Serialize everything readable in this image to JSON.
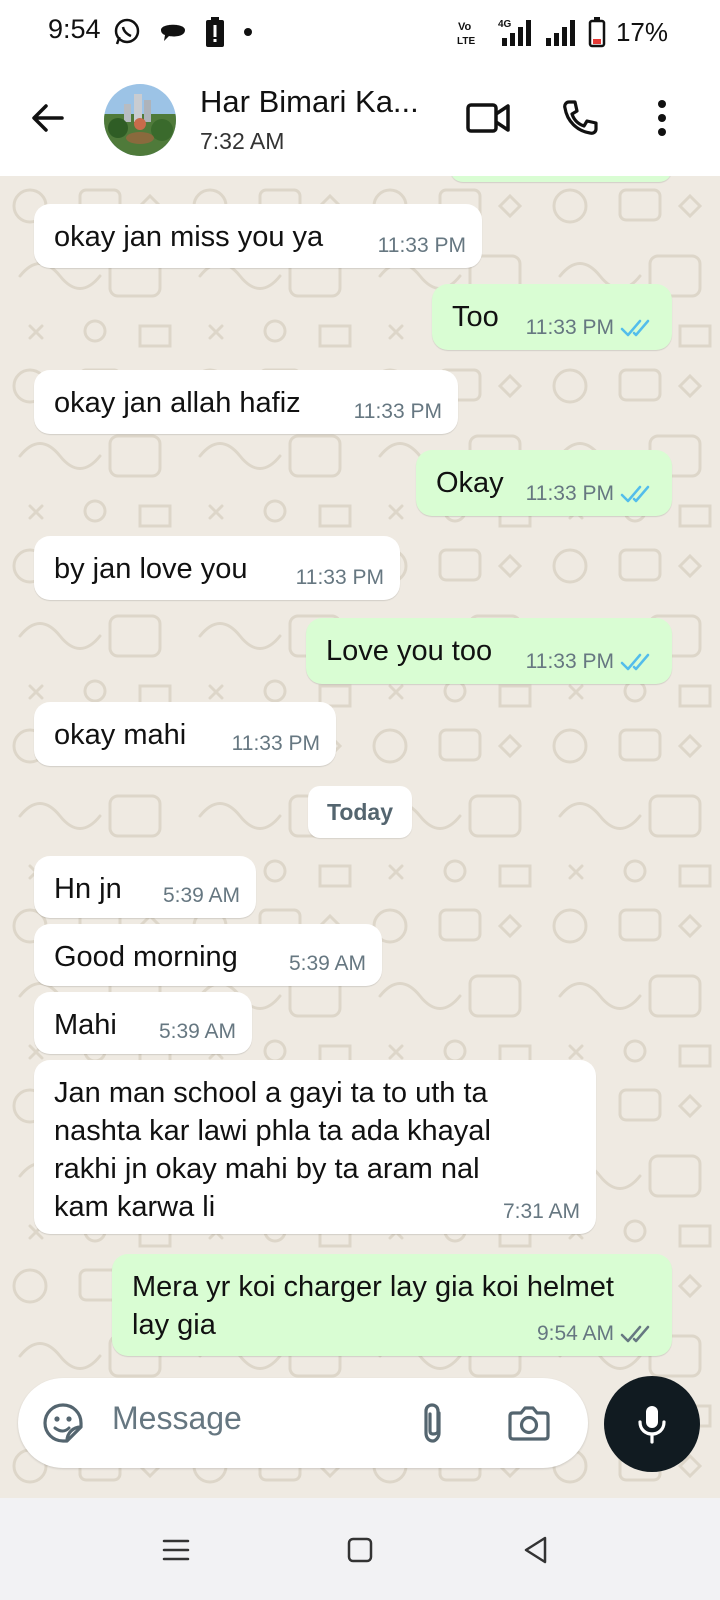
{
  "status_bar": {
    "time": "9:54",
    "network_4g": "4G",
    "volte": "Vo LTE",
    "battery_percent": "17%"
  },
  "header": {
    "contact_name": "Har Bimari Ka...",
    "last_seen": "7:32 AM"
  },
  "messages": [
    {
      "direction": "in",
      "text": "okay jan miss you ya",
      "time": "11:33 PM"
    },
    {
      "direction": "out",
      "text": "Too",
      "time": "11:33 PM",
      "status": "read"
    },
    {
      "direction": "in",
      "text": "okay jan allah hafiz",
      "time": "11:33 PM"
    },
    {
      "direction": "out",
      "text": "Okay",
      "time": "11:33 PM",
      "status": "read"
    },
    {
      "direction": "in",
      "text": "by jan love you",
      "time": "11:33 PM"
    },
    {
      "direction": "out",
      "text": "Love you too",
      "time": "11:33 PM",
      "status": "read"
    },
    {
      "direction": "in",
      "text": "okay mahi",
      "time": "11:33 PM"
    },
    {
      "direction": "in",
      "text": "Hn jn",
      "time": "5:39 AM"
    },
    {
      "direction": "in",
      "text": "Good morning",
      "time": "5:39 AM"
    },
    {
      "direction": "in",
      "text": "Mahi",
      "time": "5:39 AM"
    },
    {
      "direction": "in",
      "text_lines": [
        "Jan man school a gayi ta to uth ta",
        "nashta kar lawi phla ta ada khayal",
        "rakhi jn okay mahi by ta aram nal",
        "kam karwa li"
      ],
      "time": "7:31 AM"
    },
    {
      "direction": "out",
      "text_lines": [
        "Mera yr koi charger lay gia koi helmet",
        "lay gia"
      ],
      "time": "9:54 AM",
      "status": "delivered"
    }
  ],
  "date_separator": "Today",
  "composer": {
    "placeholder": "Message"
  },
  "colors": {
    "incoming_bubble": "#ffffff",
    "outgoing_bubble": "#d9fdd3",
    "read_ticks": "#53bdeb",
    "delivered_ticks": "#667781",
    "wallpaper": "#efeae2",
    "mic_button": "#111b21"
  }
}
